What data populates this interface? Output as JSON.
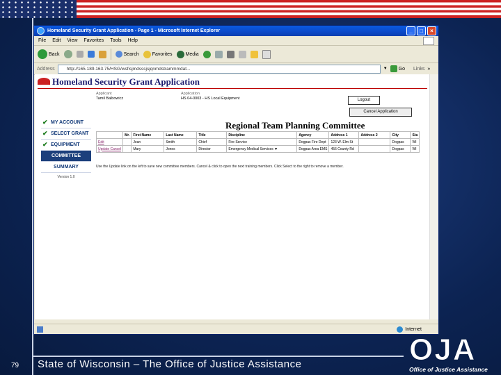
{
  "slide": {
    "number": "79",
    "footer": "State of Wisconsin – The Office of Justice Assistance",
    "logo_text": "OJA",
    "logo_subtitle": "Office of Justice Assistance"
  },
  "browser": {
    "title": "Homeland Security Grant Application - Page 1 - Microsoft Internet Explorer",
    "menu": [
      "File",
      "Edit",
      "View",
      "Favorites",
      "Tools",
      "Help"
    ],
    "toolbar": {
      "back": "Back",
      "search": "Search",
      "favorites": "Favorites",
      "media": "Media"
    },
    "address_label": "Address",
    "address_value": "http://165.189.163.75/HSG/wsfisjmdsssjsjqnmdstrammmdat...",
    "go_label": "Go",
    "links_label": "Links",
    "status_zone": "Internet"
  },
  "page": {
    "app_title": "Homeland Security Grant Application",
    "applicant_label": "Applicant",
    "applicant_value": "Tamil Balbowicz",
    "application_label": "Application",
    "application_value": "HS 04-0003 - HS Local Equipment",
    "logout_label": "Logout",
    "cancel_label": "Cancel Application",
    "section_title": "Regional Team Planning Committee",
    "nav": [
      {
        "label": "MY ACCOUNT",
        "checked": true
      },
      {
        "label": "SELECT GRANT",
        "checked": true
      },
      {
        "label": "EQUIPMENT",
        "checked": true
      },
      {
        "label": "COMMITTEE",
        "active": true
      },
      {
        "label": "SUMMARY"
      }
    ],
    "nav_footer": "Version 1.0",
    "table": {
      "headers": [
        "",
        "Mr.",
        "First Name",
        "Last Name",
        "Title",
        "Discipline",
        "Agency",
        "Address 1",
        "Address 2",
        "City",
        "Sta"
      ],
      "rows": [
        [
          "Edit",
          "",
          "Jean",
          "Smith",
          "Chief",
          "Fire Service",
          "Dogpas Fire Dept",
          "123 W. Elm St",
          "",
          "Dogpas",
          "WI"
        ],
        [
          "Update  Cancel",
          "",
          "Mary",
          "Jones",
          "Director",
          "Emergency Medical Services",
          "Dogpas Area EMS",
          "456 County Rd",
          "",
          "Dogpas",
          "WI"
        ]
      ]
    },
    "note": "Use the Update link on the left to save new committee members. Cancel & click to open the next training members. Click Select to the right to remove a member."
  }
}
